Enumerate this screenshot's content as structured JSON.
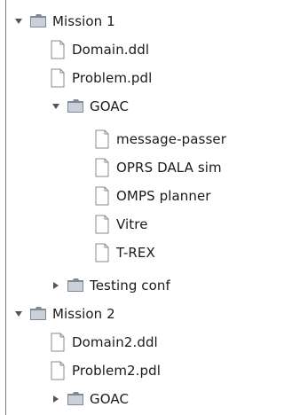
{
  "tree": {
    "nodes": [
      {
        "label": "Mission 1",
        "type": "folder",
        "state": "expanded"
      },
      {
        "label": "Domain.ddl",
        "type": "file"
      },
      {
        "label": "Problem.pdl",
        "type": "file"
      },
      {
        "label": "GOAC",
        "type": "folder",
        "state": "expanded"
      },
      {
        "label": "message-passer",
        "type": "file"
      },
      {
        "label": "OPRS DALA sim",
        "type": "file"
      },
      {
        "label": "OMPS planner",
        "type": "file"
      },
      {
        "label": "Vitre",
        "type": "file"
      },
      {
        "label": "T-REX",
        "type": "file"
      },
      {
        "label": "Testing conf",
        "type": "folder",
        "state": "collapsed"
      },
      {
        "label": "Mission 2",
        "type": "folder",
        "state": "expanded"
      },
      {
        "label": "Domain2.ddl",
        "type": "file"
      },
      {
        "label": "Problem2.pdl",
        "type": "file"
      },
      {
        "label": "GOAC",
        "type": "folder",
        "state": "collapsed"
      }
    ]
  },
  "icons": {
    "expanded": "triangle-down-icon",
    "collapsed": "triangle-right-icon",
    "folder": "folder-icon",
    "file": "file-icon"
  },
  "colors": {
    "folder_tab": "#7f8a95",
    "folder_body": "#c9d0d7",
    "file_border": "#8a8a8a",
    "toggle": "#555555",
    "text": "#1a1a1a"
  }
}
